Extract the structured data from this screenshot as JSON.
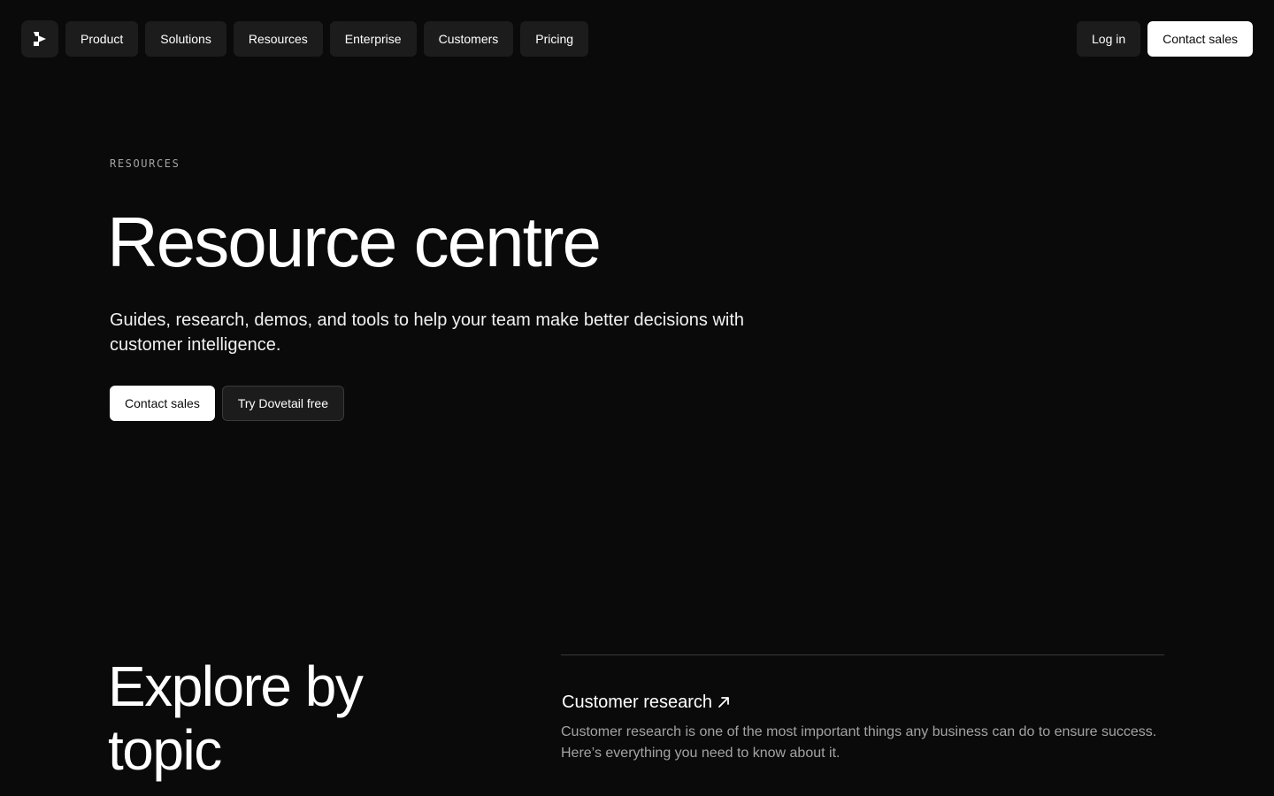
{
  "nav": {
    "logo_icon": "dovetail-logo-icon",
    "items": [
      {
        "label": "Product"
      },
      {
        "label": "Solutions"
      },
      {
        "label": "Resources"
      },
      {
        "label": "Enterprise"
      },
      {
        "label": "Customers"
      },
      {
        "label": "Pricing"
      }
    ],
    "login_label": "Log in",
    "contact_label": "Contact sales"
  },
  "hero": {
    "eyebrow": "RESOURCES",
    "title": "Resource centre",
    "subtitle": "Guides, research, demos, and tools to help your team make better decisions with customer intelligence.",
    "primary_cta": "Contact sales",
    "secondary_cta": "Try Dovetail free"
  },
  "explore": {
    "title": "Explore by topic",
    "topics": [
      {
        "title": "Customer research",
        "icon": "arrow-up-right-icon",
        "description": "Customer research is one of the most important things any business can do to ensure success. Here’s everything you need to know about it."
      }
    ]
  },
  "colors": {
    "background": "#0a0a0a",
    "surface": "#1c1c1c",
    "text_primary": "#ffffff",
    "text_muted": "#a3a3a3"
  }
}
